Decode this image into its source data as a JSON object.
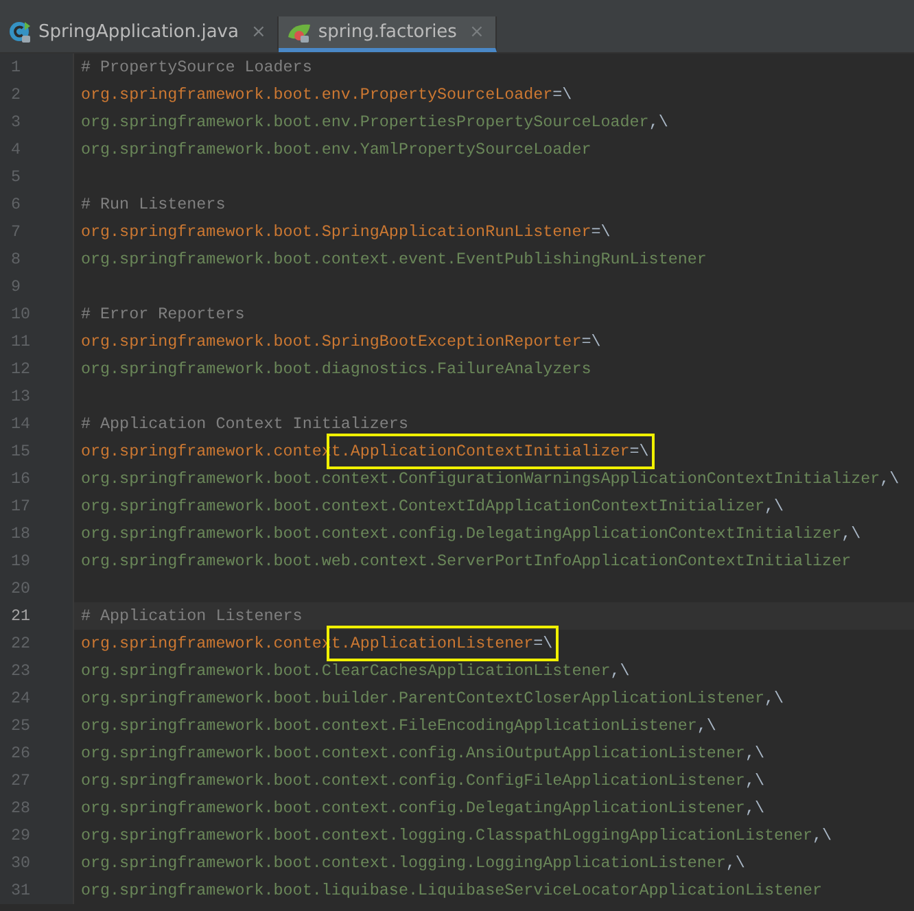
{
  "tabs": [
    {
      "label": "SpringApplication.java",
      "close": "×",
      "selected": false
    },
    {
      "label": "spring.factories",
      "close": "×",
      "selected": true
    }
  ],
  "lines": [
    {
      "number": "1",
      "current": false,
      "segments": [
        {
          "kind": "comment",
          "text": "# PropertySource Loaders"
        }
      ]
    },
    {
      "number": "2",
      "current": false,
      "segments": [
        {
          "kind": "key",
          "text": "org.springframework.boot.env.PropertySourceLoader"
        },
        {
          "kind": "op",
          "text": "=\\"
        }
      ]
    },
    {
      "number": "3",
      "current": false,
      "segments": [
        {
          "kind": "value",
          "text": "org.springframework.boot.env.PropertiesPropertySourceLoader"
        },
        {
          "kind": "op",
          "text": ",\\"
        }
      ]
    },
    {
      "number": "4",
      "current": false,
      "segments": [
        {
          "kind": "value",
          "text": "org.springframework.boot.env.YamlPropertySourceLoader"
        }
      ]
    },
    {
      "number": "5",
      "current": false
    },
    {
      "number": "6",
      "current": false,
      "segments": [
        {
          "kind": "comment",
          "text": "# Run Listeners"
        }
      ]
    },
    {
      "number": "7",
      "current": false,
      "segments": [
        {
          "kind": "key",
          "text": "org.springframework.boot.SpringApplicationRunListener"
        },
        {
          "kind": "op",
          "text": "=\\"
        }
      ]
    },
    {
      "number": "8",
      "current": false,
      "segments": [
        {
          "kind": "value",
          "text": "org.springframework.boot.context.event.EventPublishingRunListener"
        }
      ]
    },
    {
      "number": "9",
      "current": false
    },
    {
      "number": "10",
      "current": false,
      "segments": [
        {
          "kind": "comment",
          "text": "# Error Reporters"
        }
      ]
    },
    {
      "number": "11",
      "current": false,
      "segments": [
        {
          "kind": "key",
          "text": "org.springframework.boot.SpringBootExceptionReporter"
        },
        {
          "kind": "op",
          "text": "=\\"
        }
      ]
    },
    {
      "number": "12",
      "current": false,
      "segments": [
        {
          "kind": "value",
          "text": "org.springframework.boot.diagnostics.FailureAnalyzers"
        }
      ]
    },
    {
      "number": "13",
      "current": false
    },
    {
      "number": "14",
      "current": false,
      "segments": [
        {
          "kind": "comment",
          "text": "# Application Context Initializers"
        }
      ]
    },
    {
      "number": "15",
      "current": false,
      "segments": [
        {
          "kind": "key",
          "text": "org.springframework.contex"
        },
        {
          "kind": "highlight",
          "segments": [
            {
              "kind": "key",
              "text": "t.ApplicationContextInitializer"
            },
            {
              "kind": "op",
              "text": "=\\"
            }
          ]
        }
      ]
    },
    {
      "number": "16",
      "current": false,
      "segments": [
        {
          "kind": "value",
          "text": "org.springframework.boot.context.ConfigurationWarningsApplicationContextInitializer"
        },
        {
          "kind": "op",
          "text": ",\\"
        }
      ]
    },
    {
      "number": "17",
      "current": false,
      "segments": [
        {
          "kind": "value",
          "text": "org.springframework.boot.context.ContextIdApplicationContextInitializer"
        },
        {
          "kind": "op",
          "text": ",\\"
        }
      ]
    },
    {
      "number": "18",
      "current": false,
      "segments": [
        {
          "kind": "value",
          "text": "org.springframework.boot.context.config.DelegatingApplicationContextInitializer"
        },
        {
          "kind": "op",
          "text": ",\\"
        }
      ]
    },
    {
      "number": "19",
      "current": false,
      "segments": [
        {
          "kind": "value",
          "text": "org.springframework.boot.web.context.ServerPortInfoApplicationContextInitializer"
        }
      ]
    },
    {
      "number": "20",
      "current": false
    },
    {
      "number": "21",
      "current": true,
      "segments": [
        {
          "kind": "comment",
          "text": "# Application Listeners"
        }
      ]
    },
    {
      "number": "22",
      "current": false,
      "segments": [
        {
          "kind": "key",
          "text": "org.springframework.contex"
        },
        {
          "kind": "highlight",
          "segments": [
            {
              "kind": "key",
              "text": "t.ApplicationListener"
            },
            {
              "kind": "op",
              "text": "=\\"
            }
          ]
        }
      ]
    },
    {
      "number": "23",
      "current": false,
      "segments": [
        {
          "kind": "value",
          "text": "org.springframework.boot.ClearCachesApplicationListener"
        },
        {
          "kind": "op",
          "text": ",\\"
        }
      ]
    },
    {
      "number": "24",
      "current": false,
      "segments": [
        {
          "kind": "value",
          "text": "org.springframework.boot.builder.ParentContextCloserApplicationListener"
        },
        {
          "kind": "op",
          "text": ",\\"
        }
      ]
    },
    {
      "number": "25",
      "current": false,
      "segments": [
        {
          "kind": "value",
          "text": "org.springframework.boot.context.FileEncodingApplicationListener"
        },
        {
          "kind": "op",
          "text": ",\\"
        }
      ]
    },
    {
      "number": "26",
      "current": false,
      "segments": [
        {
          "kind": "value",
          "text": "org.springframework.boot.context.config.AnsiOutputApplicationListener"
        },
        {
          "kind": "op",
          "text": ",\\"
        }
      ]
    },
    {
      "number": "27",
      "current": false,
      "segments": [
        {
          "kind": "value",
          "text": "org.springframework.boot.context.config.ConfigFileApplicationListener"
        },
        {
          "kind": "op",
          "text": ",\\"
        }
      ]
    },
    {
      "number": "28",
      "current": false,
      "segments": [
        {
          "kind": "value",
          "text": "org.springframework.boot.context.config.DelegatingApplicationListener"
        },
        {
          "kind": "op",
          "text": ",\\"
        }
      ]
    },
    {
      "number": "29",
      "current": false,
      "segments": [
        {
          "kind": "value",
          "text": "org.springframework.boot.context.logging.ClasspathLoggingApplicationListener"
        },
        {
          "kind": "op",
          "text": ",\\"
        }
      ]
    },
    {
      "number": "30",
      "current": false,
      "segments": [
        {
          "kind": "value",
          "text": "org.springframework.boot.context.logging.LoggingApplicationListener"
        },
        {
          "kind": "op",
          "text": ",\\"
        }
      ]
    },
    {
      "number": "31",
      "current": false,
      "segments": [
        {
          "kind": "value",
          "text": "org.springframework.boot.liquibase.LiquibaseServiceLocatorApplicationListener"
        }
      ]
    }
  ]
}
